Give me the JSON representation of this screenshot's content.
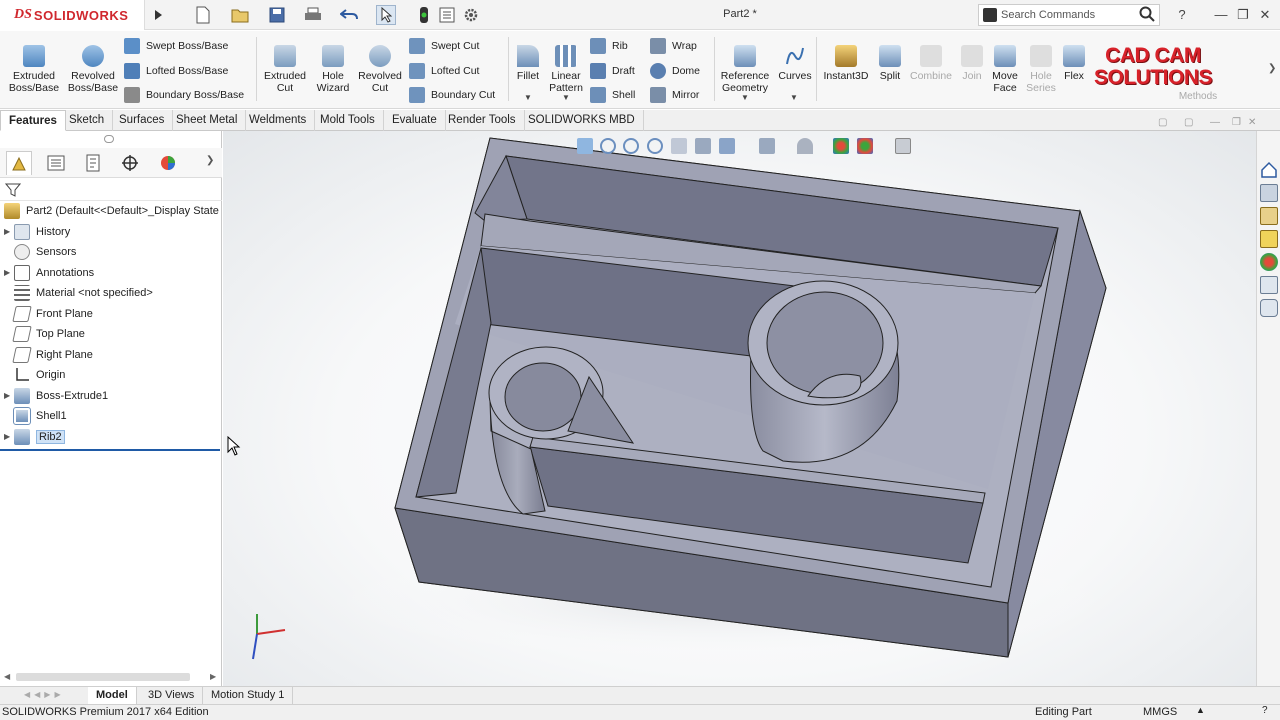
{
  "app": {
    "brand_prefix": "DS",
    "brand_name": "SOLIDWORKS",
    "document_title": "Part2 *",
    "search_placeholder": "Search Commands",
    "watermark": "CAD CAM SOLUTIONS",
    "watermark_line1": "CAD CAM",
    "watermark_line2": "SOLUTIONS"
  },
  "ribbon": {
    "extruded_boss": "Extruded Boss/Base",
    "revolved_boss": "Revolved Boss/Base",
    "swept_boss": "Swept Boss/Base",
    "lofted_boss": "Lofted Boss/Base",
    "boundary_boss": "Boundary Boss/Base",
    "extruded_cut": "Extruded Cut",
    "hole_wizard": "Hole Wizard",
    "revolved_cut": "Revolved Cut",
    "swept_cut": "Swept Cut",
    "lofted_cut": "Lofted Cut",
    "boundary_cut": "Boundary Cut",
    "fillet": "Fillet",
    "linear_pattern": "Linear Pattern",
    "rib": "Rib",
    "draft": "Draft",
    "shell": "Shell",
    "wrap": "Wrap",
    "dome": "Dome",
    "mirror": "Mirror",
    "reference_geometry": "Reference Geometry",
    "curves": "Curves",
    "instant3d": "Instant3D",
    "split": "Split",
    "combine": "Combine",
    "join": "Join",
    "move_face": "Move Face",
    "hole_series": "Hole Series",
    "flex": "Flex",
    "methods": "Methods"
  },
  "tabs": [
    "Features",
    "Sketch",
    "Surfaces",
    "Sheet Metal",
    "Weldments",
    "Mold Tools",
    "Evaluate",
    "Render Tools",
    "SOLIDWORKS MBD"
  ],
  "tree": {
    "root": "Part2  (Default<<Default>_Display State",
    "items": [
      "History",
      "Sensors",
      "Annotations",
      "Material <not specified>",
      "Front Plane",
      "Top Plane",
      "Right Plane",
      "Origin",
      "Boss-Extrude1",
      "Shell1",
      "Rib2"
    ]
  },
  "bottom_tabs": [
    "Model",
    "3D Views",
    "Motion Study 1"
  ],
  "status": {
    "edition": "SOLIDWORKS Premium 2017 x64 Edition",
    "mode": "Editing Part",
    "units": "MMGS"
  },
  "colors": {
    "brand_red": "#d0282e",
    "model_gray": "#9ea1b3",
    "selection_blue": "#1f5aa6"
  }
}
